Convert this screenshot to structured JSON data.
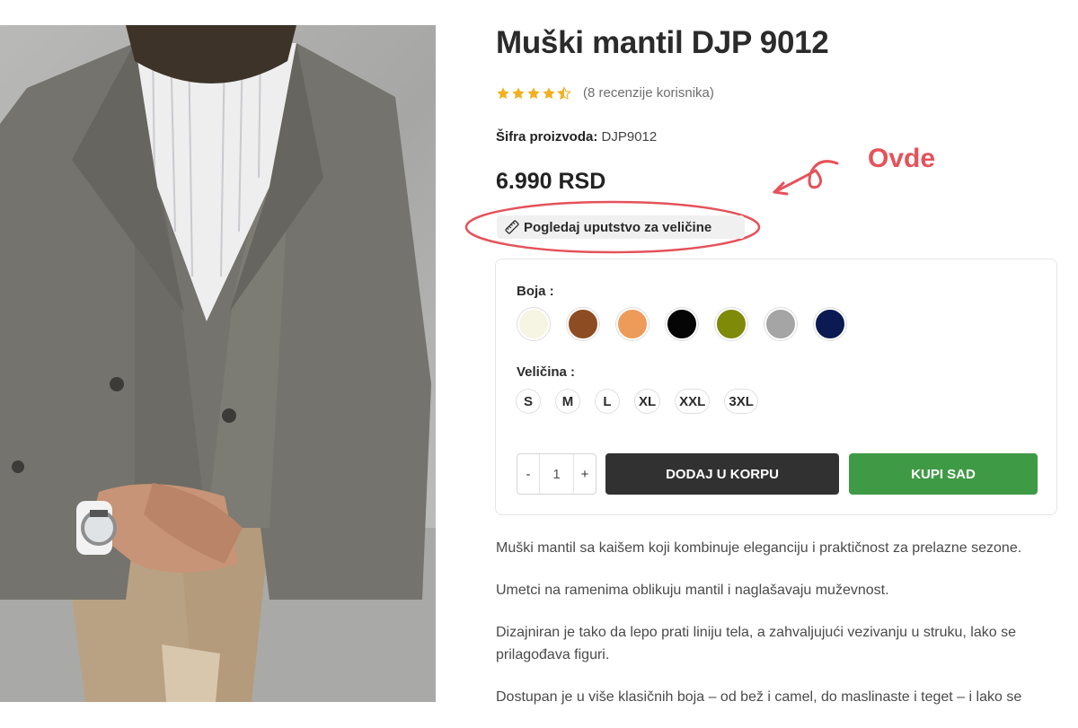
{
  "product": {
    "title": "Muški mantil DJP 9012",
    "rating": 4.5,
    "reviews_text": "(8 recenzije korisnika)",
    "sku_label": "Šifra proizvoda:",
    "sku_value": "DJP9012",
    "price": "6.990 RSD",
    "size_guide_label": "Pogledaj uputstvo za veličine"
  },
  "annotation": {
    "text": "Ovde",
    "color": "#e5525a"
  },
  "options": {
    "color_label": "Boja :",
    "colors": [
      "#f6f4e2",
      "#8e4c22",
      "#ee9b5a",
      "#050505",
      "#7f8a09",
      "#a5a5a5",
      "#0b1a52"
    ],
    "size_label": "Veličina :",
    "sizes": [
      "S",
      "M",
      "L",
      "XL",
      "XXL",
      "3XL"
    ]
  },
  "purchase": {
    "minus": "-",
    "quantity": "1",
    "plus": "+",
    "add_to_cart": "DODAJ U KORPU",
    "buy_now": "KUPI SAD"
  },
  "description": [
    "Muški mantil sa kaišem koji kombinuje eleganciju i praktičnost za prelazne sezone.",
    "Umetci na ramenima oblikuju mantil i naglašavaju muževnost.",
    "Dizajniran je tako da lepo prati liniju tela, a zahvaljujući vezivanju u struku, lako se prilagođava figuri.",
    "Dostupan je u više klasičnih boja – od bež i camel, do maslinaste i teget – i lako se"
  ]
}
